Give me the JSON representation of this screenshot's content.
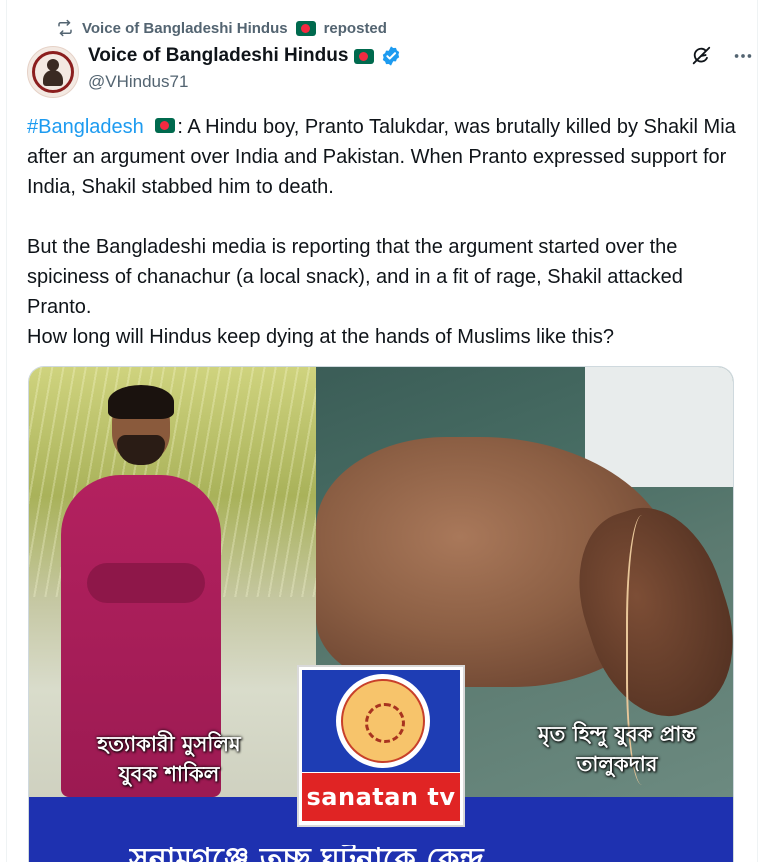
{
  "repost": {
    "label_name": "Voice of Bangladeshi Hindus",
    "label_suffix": "reposted",
    "icon": "repost-icon"
  },
  "author": {
    "display_name": "Voice of Bangladeshi Hindus",
    "handle": "@VHindus71",
    "verified": true,
    "flag_colors": {
      "field": "#006a4e",
      "disc": "#f42a41"
    }
  },
  "actions": {
    "grok_icon": "grok-icon",
    "more_icon": "more-icon"
  },
  "tweet": {
    "hashtag": "#Bangladesh",
    "p1_rest": ":  A Hindu boy, Pranto Talukdar, was brutally killed by Shakil Mia after an argument over India and Pakistan. When Pranto expressed support for India, Shakil stabbed him to death.",
    "p2": "But the Bangladeshi media is reporting that the argument started over the spiciness of chanachur (a local snack), and in a fit of rage, Shakil attacked Pranto.",
    "p3": "How long will Hindus keep dying at the hands of Muslims like this?"
  },
  "media": {
    "caption_left_line1": "হত্যাকারী মুসলিম",
    "caption_left_line2": "যুবক শাকিল",
    "caption_right_line1": "মৃত হিন্দু যুবক প্রান্ত",
    "caption_right_line2": "তালুকদার",
    "logo_text": "sanatan tv",
    "bottom_banner": "সুনামগঞ্জে তুচ্ছ ঘটনাকে কেন্দ্র"
  },
  "colors": {
    "link": "#1d9bf0",
    "muted": "#536471",
    "text": "#0f1419",
    "banner_blue": "#1e31b0",
    "logo_red": "#e02424"
  }
}
